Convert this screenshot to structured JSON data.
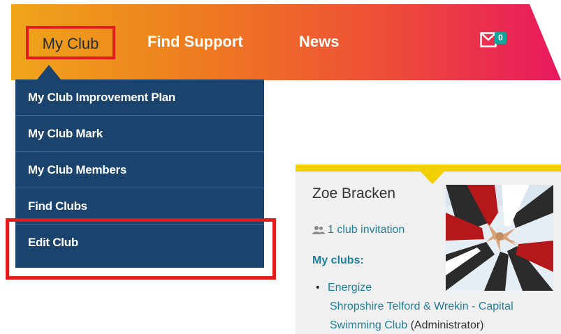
{
  "nav": {
    "my_club": "My Club",
    "find_support": "Find Support",
    "news": "News",
    "mail_count": "0"
  },
  "dropdown": {
    "items": [
      {
        "label": "My Club Improvement Plan"
      },
      {
        "label": "My Club Mark"
      },
      {
        "label": "My Club Members"
      },
      {
        "label": "Find Clubs"
      },
      {
        "label": "Edit Club"
      }
    ]
  },
  "profile": {
    "name": "Zoe Bracken",
    "invitation": "1 club invitation",
    "my_clubs_label": "My clubs:",
    "clubs": [
      {
        "name_line1": "Energize",
        "name_line2": "Shropshire Telford & Wrekin - Capital",
        "name_line3": "Swimming Club",
        "role": "(Administrator)"
      }
    ]
  },
  "colors": {
    "nav_gradient_start": "#efa51a",
    "nav_gradient_end": "#e8185e",
    "dropdown_bg": "#1a446e",
    "highlight_red": "#e41c1c",
    "accent_teal": "#1f7f99",
    "card_accent_yellow": "#f1cf00"
  }
}
